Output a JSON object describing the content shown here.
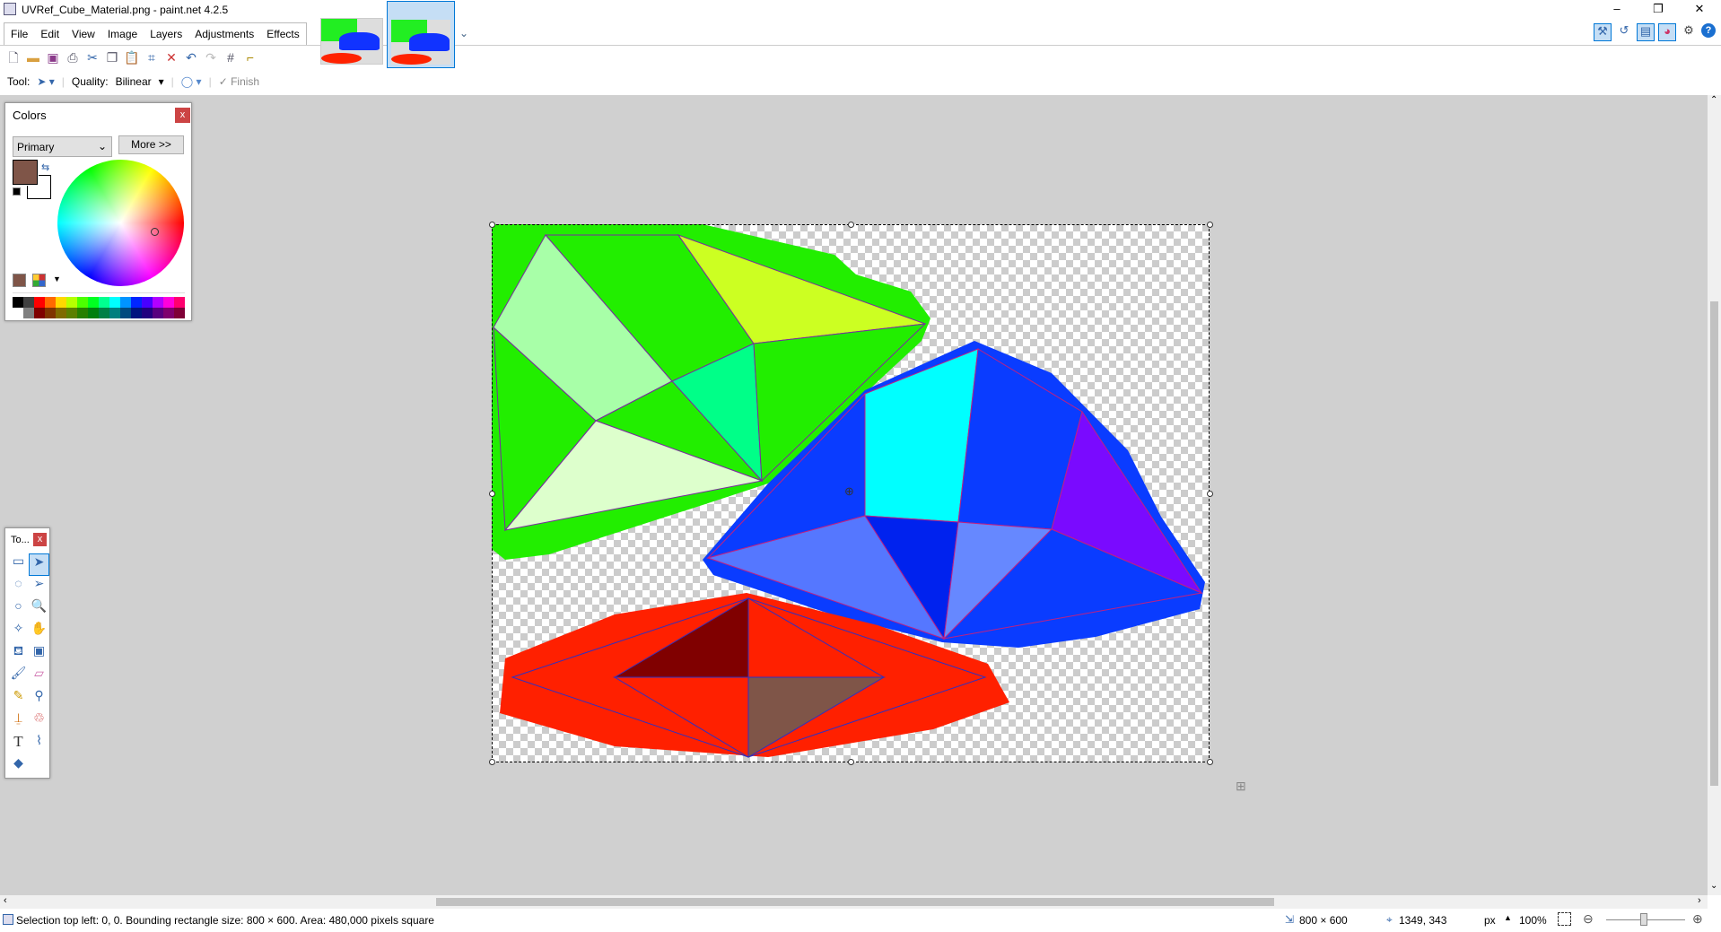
{
  "window": {
    "title": "UVRef_Cube_Material.png - paint.net 4.2.5",
    "minimize": "–",
    "restore": "❐",
    "close": "✕"
  },
  "menu": [
    "File",
    "Edit",
    "View",
    "Image",
    "Layers",
    "Adjustments",
    "Effects"
  ],
  "toolbar_icons": [
    "new-icon",
    "open-icon",
    "save-icon",
    "print-icon",
    "cut-icon",
    "copy-icon",
    "paste-icon",
    "crop-icon",
    "deselect-icon",
    "undo-icon",
    "redo-icon",
    "grid-icon",
    "ruler-icon"
  ],
  "tool_options": {
    "tool_label": "Tool:",
    "quality_label": "Quality:",
    "quality_value": "Bilinear",
    "finish_label": "Finish"
  },
  "colors_panel": {
    "title": "Colors",
    "mode": "Primary",
    "more_button": "More >>",
    "primary_color": "#7f5548",
    "secondary_color": "#ffffff",
    "palette_top": [
      "#000000",
      "#404040",
      "#ff0000",
      "#ff6a00",
      "#ffd800",
      "#b6ff00",
      "#4cff00",
      "#00ff21",
      "#00ff90",
      "#00ffff",
      "#0094ff",
      "#0026ff",
      "#4800ff",
      "#b200ff",
      "#ff00dc",
      "#ff006e"
    ],
    "palette_bottom": [
      "#ffffff",
      "#808080",
      "#7f0000",
      "#7f3300",
      "#7f6a00",
      "#5b7f00",
      "#267f00",
      "#007f0e",
      "#007f46",
      "#007f7f",
      "#004a7f",
      "#00137f",
      "#21007f",
      "#57007f",
      "#7f006e",
      "#7f0037"
    ]
  },
  "tools_panel": {
    "title": "To...",
    "close": "x"
  },
  "status": {
    "text": "Selection top left: 0, 0. Bounding rectangle size: 800 × 600. Area: 480,000 pixels square",
    "image_size": "800 × 600",
    "cursor": "1349, 343",
    "units": "px",
    "zoom": "100%"
  }
}
